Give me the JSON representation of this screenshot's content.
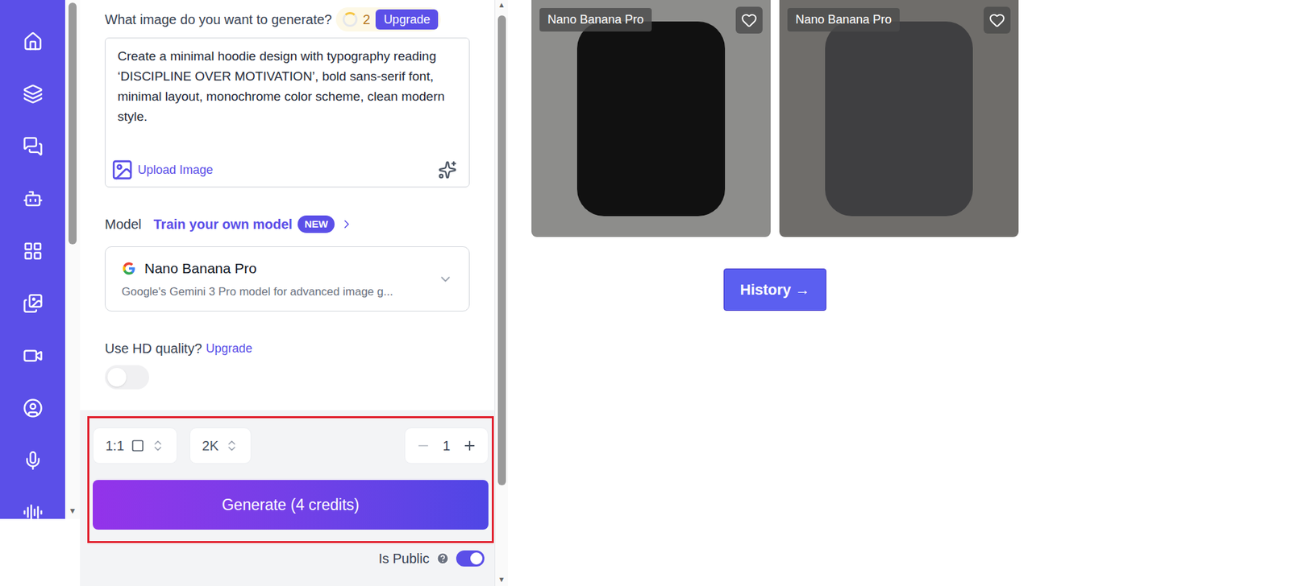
{
  "form": {
    "prompt_label": "What image do you want to generate?",
    "credits": "2",
    "upgrade": "Upgrade",
    "prompt": "Create a minimal hoodie design with typography reading ‘DISCIPLINE OVER MOTIVATION’, bold sans-serif font, minimal layout, monochrome color scheme, clean modern style.",
    "upload_image": "Upload Image"
  },
  "model": {
    "label": "Model",
    "train_link": "Train your own model",
    "badge": "NEW",
    "name": "Nano Banana Pro",
    "description": "Google's Gemini 3 Pro model for advanced image g..."
  },
  "hd": {
    "label": "Use HD quality?",
    "upgrade": "Upgrade",
    "on": false
  },
  "controls": {
    "aspect": "1:1",
    "resolution": "2K",
    "count": "1",
    "generate": "Generate (4 credits)"
  },
  "public": {
    "label": "Is Public",
    "on": true
  },
  "gallery": [
    {
      "model": "Nano Banana Pro",
      "liked": false
    },
    {
      "model": "Nano Banana Pro",
      "liked": false
    }
  ],
  "history_button": "History →"
}
